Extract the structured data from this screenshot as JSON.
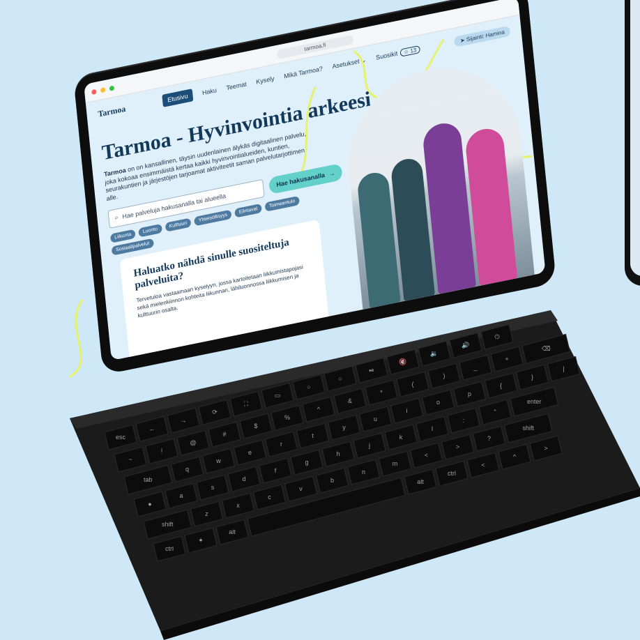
{
  "browser": {
    "url": "tarmoa.fi"
  },
  "site": {
    "logo": "Tarmoa",
    "nav": [
      {
        "label": "Etusivu",
        "active": true
      },
      {
        "label": "Haku"
      },
      {
        "label": "Teemat"
      },
      {
        "label": "Kysely"
      },
      {
        "label": "Mikä Tarmoa?"
      },
      {
        "label": "Asetukset"
      }
    ],
    "favorites_label": "Suosikit",
    "favorites_count": "13",
    "location_label": "Sijainti: Hamina"
  },
  "hero": {
    "title": "Tarmoa - Hyvinvointia arkeesi",
    "intro_brand": "Tarmoa",
    "intro_text": "on on kansallinen, täysin uudenlainen älykäs digitaalinen palvelu, joka kokoaa ensimmäistä kertaa kaikki hyvinvointialueiden, kuntien, seurakuntien ja järjestöjen tarjoamat aktiviteetit saman palvelutarjottimen alle.",
    "search_placeholder": "Hae palveluja hakusanalla tai alueella",
    "search_button": "Hae hakusanalla",
    "chips": [
      "Liikunta",
      "Luonto",
      "Kulttuuri",
      "Yhteisöllisyys",
      "Elintavat",
      "Toimeentulo",
      "Sosiaalipalvelut"
    ]
  },
  "card": {
    "title": "Haluatko nähdä sinulle suositeltuja palveluita?",
    "text": "Tervetuloa vastaamaan kyselyyn, jossa kartoitetaan liikkumistapojasi sekä mielenkiinnon kohteita liikunnan, lähiluonnossa liikkumisen ja kulttuurin osalta."
  },
  "keyboard": {
    "rows": [
      [
        "esc",
        "←",
        "→",
        "⟳",
        "⛶",
        "▭",
        "○",
        "○",
        "⏯",
        "🔇",
        "🔉",
        "🔊",
        "⏻"
      ],
      [
        "~",
        "!",
        "@",
        "#",
        "$",
        "%",
        "^",
        "&",
        "*",
        "(",
        ")",
        "_",
        "+",
        "⌫"
      ],
      [
        "tab",
        "q",
        "w",
        "e",
        "r",
        "t",
        "y",
        "u",
        "i",
        "o",
        "p",
        "{",
        "}",
        "|"
      ],
      [
        "●",
        "a",
        "s",
        "d",
        "f",
        "g",
        "h",
        "j",
        "k",
        "l",
        ":",
        "\"",
        "enter"
      ],
      [
        "shift",
        "z",
        "x",
        "c",
        "v",
        "b",
        "n",
        "m",
        "<",
        ">",
        "?",
        "shift"
      ],
      [
        "ctrl",
        "✦",
        "alt",
        "",
        "alt",
        "ctrl",
        "<",
        "^",
        ">"
      ]
    ]
  },
  "colors": {
    "background": "#cfe8f7",
    "screen_bg": "#dff0fb",
    "brand_dark": "#12385a",
    "accent_teal": "#63d0c9",
    "chip": "#4e7aa0",
    "yellow_line": "#e6f26a"
  }
}
